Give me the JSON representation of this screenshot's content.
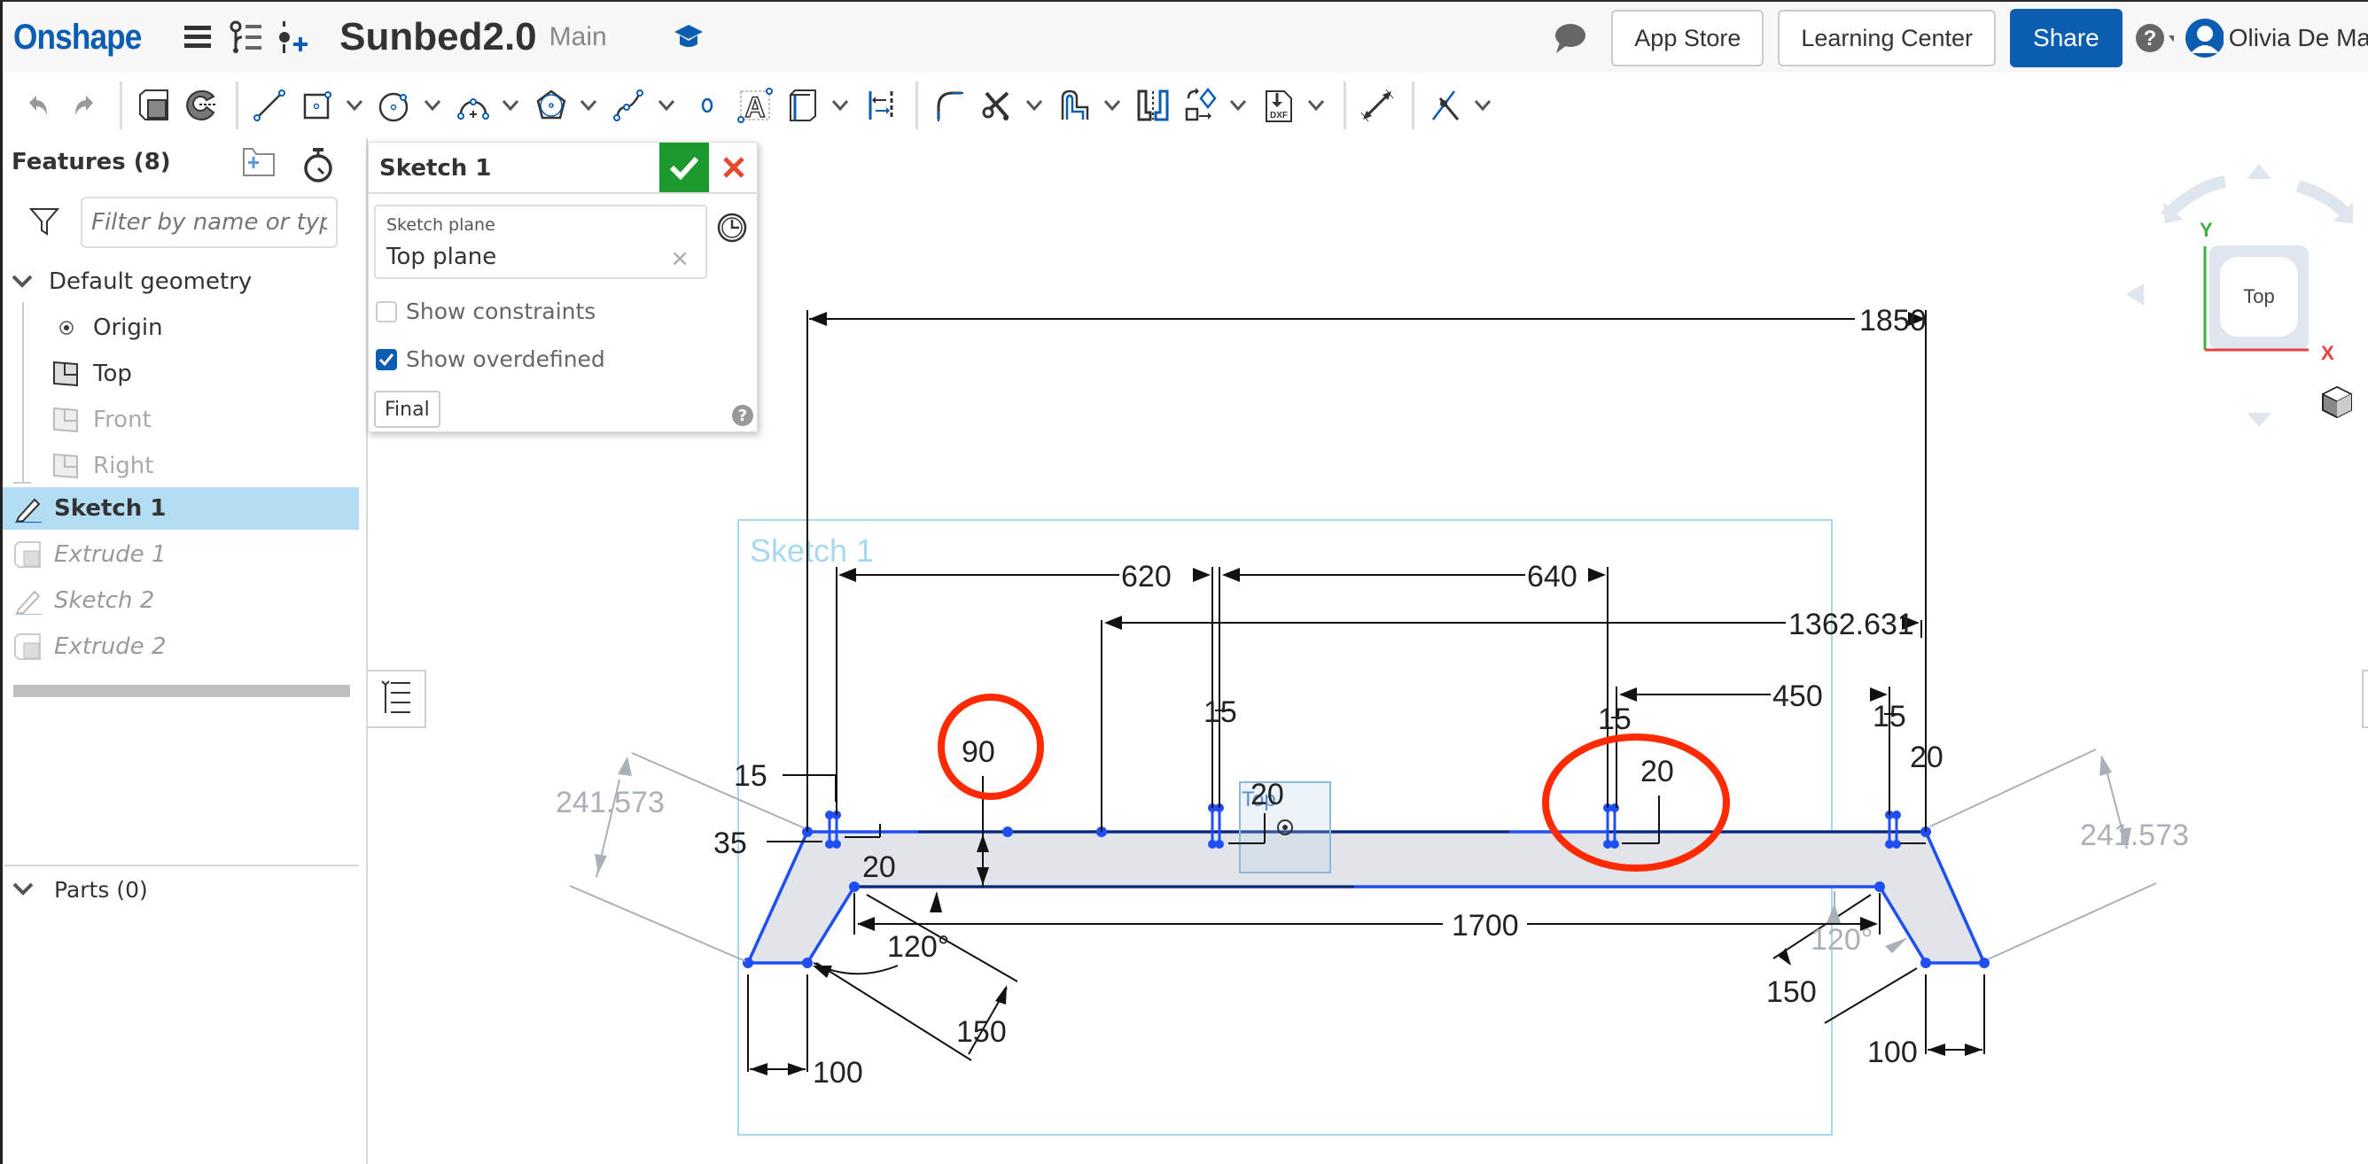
{
  "header": {
    "logo": "Onshape",
    "document_title": "Sunbed2.0",
    "branch": "Main",
    "app_store": "App Store",
    "learning_center": "Learning Center",
    "share": "Share",
    "user_name": "Olivia De Ma",
    "icons": [
      "menu-icon",
      "version-graph-icon",
      "insert-icon",
      "learning-cap-icon",
      "comment-icon",
      "help-icon",
      "user-avatar-icon"
    ]
  },
  "toolbar": {
    "tools": [
      "undo",
      "redo",
      "extrude",
      "revolve",
      "line",
      "rectangle",
      "circle",
      "arc",
      "polygon",
      "spline",
      "point",
      "text",
      "construction",
      "use",
      "fillet",
      "trim",
      "offset",
      "mirror",
      "transform",
      "dxf-import",
      "dimension",
      "intersection"
    ]
  },
  "features": {
    "title": "Features (8)",
    "filter_placeholder": "Filter by name or type",
    "default_geometry": "Default geometry",
    "items": [
      {
        "label": "Origin",
        "state": "normal"
      },
      {
        "label": "Top",
        "state": "normal"
      },
      {
        "label": "Front",
        "state": "muted"
      },
      {
        "label": "Right",
        "state": "muted"
      },
      {
        "label": "Sketch 1",
        "state": "selected"
      },
      {
        "label": "Extrude 1",
        "state": "rolled-back"
      },
      {
        "label": "Sketch 2",
        "state": "rolled-back"
      },
      {
        "label": "Extrude 2",
        "state": "rolled-back"
      }
    ],
    "parts": "Parts (0)"
  },
  "dialog": {
    "title": "Sketch 1",
    "plane_label": "Sketch plane",
    "plane_value": "Top plane",
    "show_constraints": "Show constraints",
    "show_constraints_checked": false,
    "show_overdefined": "Show overdefined",
    "show_overdefined_checked": true,
    "final": "Final"
  },
  "viewcube": {
    "face": "Top",
    "x_label": "X",
    "y_label": "Y"
  },
  "sketch": {
    "label": "Sketch 1",
    "origin_label": "Top",
    "dimensions": {
      "overall": "1850",
      "d620": "620",
      "d640": "640",
      "d1362": "1362.631",
      "d450": "450",
      "d15a": "15",
      "d15b": "15",
      "d15c": "15",
      "d15d": "15",
      "d90": "90",
      "d20a": "20",
      "d20b": "20",
      "d20c": "20",
      "d20d": "20",
      "d35": "35",
      "d1700": "1700",
      "angle_left": "120°",
      "angle_right": "120°",
      "d150a": "150",
      "d150b": "150",
      "d100a": "100",
      "d100b": "100",
      "diag_left": "241.573",
      "diag_right": "241.573"
    },
    "highlight_color": "#ff2a00",
    "geometry_color": "#1f4ef5"
  }
}
